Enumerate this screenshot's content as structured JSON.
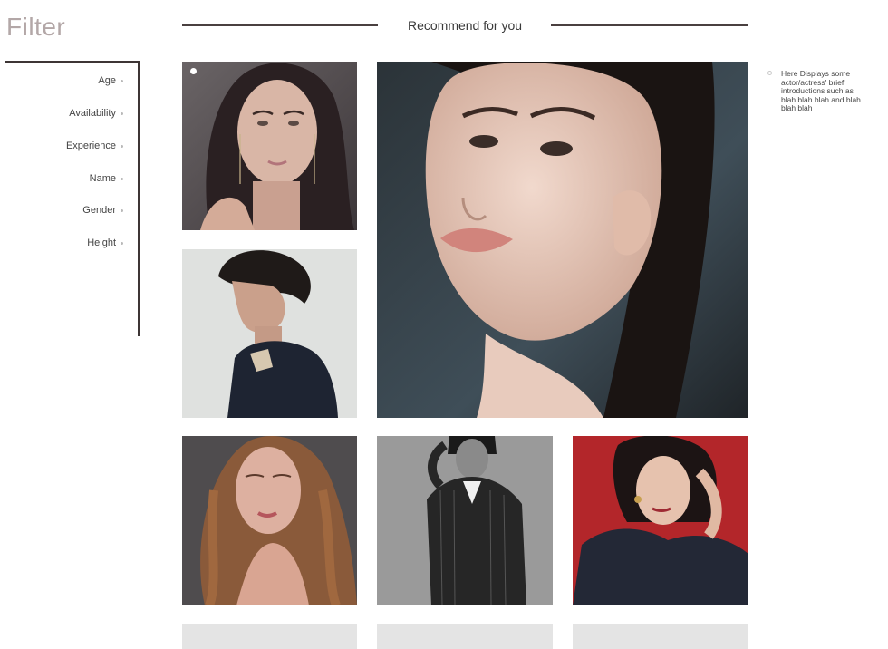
{
  "filter": {
    "title": "Filter",
    "items": [
      {
        "label": "Age"
      },
      {
        "label": "Availability"
      },
      {
        "label": "Experience"
      },
      {
        "label": "Name"
      },
      {
        "label": "Gender"
      },
      {
        "label": "Height"
      }
    ]
  },
  "recommend": {
    "title": "Recommend for you"
  },
  "info": {
    "text": "Here Displays some actor/actress' brief introductions such as blah blah blah and blah blah blah"
  },
  "colors": {
    "accent_line": "#4a4040",
    "filter_title": "#b3a7a7",
    "placeholder": "#e4e4e4"
  }
}
